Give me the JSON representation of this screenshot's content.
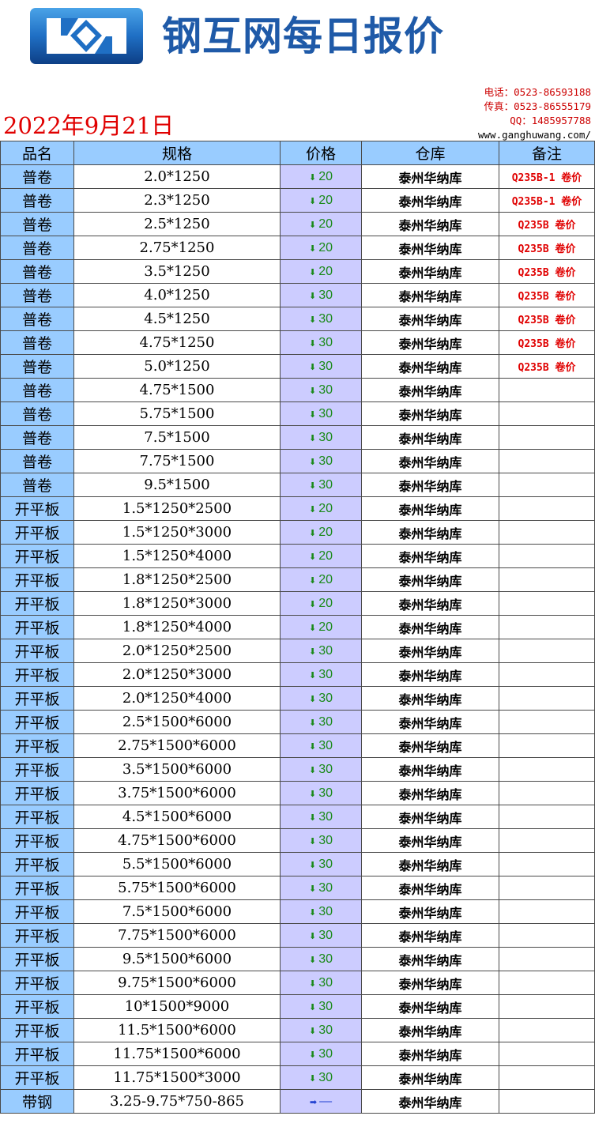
{
  "header": {
    "title": "钢互网每日报价",
    "phone": "电话：0523-86593188",
    "fax": "传真：0523-86555179",
    "qq": "QQ：1485957788",
    "website": "www.ganghuwang.com/",
    "date": "2022年9月21日",
    "colors": {
      "title": "#1f5aa8",
      "date": "#e00000",
      "header_bg": "#99ccff",
      "price_bg": "#ccccff",
      "down": "#1a8a1a",
      "flat": "#1f3fd0"
    }
  },
  "table": {
    "headers": [
      "品名",
      "规格",
      "价格",
      "仓库",
      "备注"
    ],
    "rows": [
      {
        "name": "普卷",
        "spec": "2.0*1250",
        "trend": "down",
        "price": "20",
        "warehouse": "泰州华纳库",
        "note": "Q235B-1 卷价"
      },
      {
        "name": "普卷",
        "spec": "2.3*1250",
        "trend": "down",
        "price": "20",
        "warehouse": "泰州华纳库",
        "note": "Q235B-1 卷价"
      },
      {
        "name": "普卷",
        "spec": "2.5*1250",
        "trend": "down",
        "price": "20",
        "warehouse": "泰州华纳库",
        "note": "Q235B 卷价"
      },
      {
        "name": "普卷",
        "spec": "2.75*1250",
        "trend": "down",
        "price": "20",
        "warehouse": "泰州华纳库",
        "note": "Q235B 卷价"
      },
      {
        "name": "普卷",
        "spec": "3.5*1250",
        "trend": "down",
        "price": "20",
        "warehouse": "泰州华纳库",
        "note": "Q235B 卷价"
      },
      {
        "name": "普卷",
        "spec": "4.0*1250",
        "trend": "down",
        "price": "30",
        "warehouse": "泰州华纳库",
        "note": "Q235B 卷价"
      },
      {
        "name": "普卷",
        "spec": "4.5*1250",
        "trend": "down",
        "price": "30",
        "warehouse": "泰州华纳库",
        "note": "Q235B 卷价"
      },
      {
        "name": "普卷",
        "spec": "4.75*1250",
        "trend": "down",
        "price": "30",
        "warehouse": "泰州华纳库",
        "note": "Q235B 卷价"
      },
      {
        "name": "普卷",
        "spec": "5.0*1250",
        "trend": "down",
        "price": "30",
        "warehouse": "泰州华纳库",
        "note": "Q235B 卷价"
      },
      {
        "name": "普卷",
        "spec": "4.75*1500",
        "trend": "down",
        "price": "30",
        "warehouse": "泰州华纳库",
        "note": ""
      },
      {
        "name": "普卷",
        "spec": "5.75*1500",
        "trend": "down",
        "price": "30",
        "warehouse": "泰州华纳库",
        "note": ""
      },
      {
        "name": "普卷",
        "spec": "7.5*1500",
        "trend": "down",
        "price": "30",
        "warehouse": "泰州华纳库",
        "note": ""
      },
      {
        "name": "普卷",
        "spec": "7.75*1500",
        "trend": "down",
        "price": "30",
        "warehouse": "泰州华纳库",
        "note": ""
      },
      {
        "name": "普卷",
        "spec": "9.5*1500",
        "trend": "down",
        "price": "30",
        "warehouse": "泰州华纳库",
        "note": ""
      },
      {
        "name": "开平板",
        "spec": "1.5*1250*2500",
        "trend": "down",
        "price": "20",
        "warehouse": "泰州华纳库",
        "note": ""
      },
      {
        "name": "开平板",
        "spec": "1.5*1250*3000",
        "trend": "down",
        "price": "20",
        "warehouse": "泰州华纳库",
        "note": ""
      },
      {
        "name": "开平板",
        "spec": "1.5*1250*4000",
        "trend": "down",
        "price": "20",
        "warehouse": "泰州华纳库",
        "note": ""
      },
      {
        "name": "开平板",
        "spec": "1.8*1250*2500",
        "trend": "down",
        "price": "20",
        "warehouse": "泰州华纳库",
        "note": ""
      },
      {
        "name": "开平板",
        "spec": "1.8*1250*3000",
        "trend": "down",
        "price": "20",
        "warehouse": "泰州华纳库",
        "note": ""
      },
      {
        "name": "开平板",
        "spec": "1.8*1250*4000",
        "trend": "down",
        "price": "20",
        "warehouse": "泰州华纳库",
        "note": ""
      },
      {
        "name": "开平板",
        "spec": "2.0*1250*2500",
        "trend": "down",
        "price": "30",
        "warehouse": "泰州华纳库",
        "note": ""
      },
      {
        "name": "开平板",
        "spec": "2.0*1250*3000",
        "trend": "down",
        "price": "30",
        "warehouse": "泰州华纳库",
        "note": ""
      },
      {
        "name": "开平板",
        "spec": "2.0*1250*4000",
        "trend": "down",
        "price": "30",
        "warehouse": "泰州华纳库",
        "note": ""
      },
      {
        "name": "开平板",
        "spec": "2.5*1500*6000",
        "trend": "down",
        "price": "30",
        "warehouse": "泰州华纳库",
        "note": ""
      },
      {
        "name": "开平板",
        "spec": "2.75*1500*6000",
        "trend": "down",
        "price": "30",
        "warehouse": "泰州华纳库",
        "note": ""
      },
      {
        "name": "开平板",
        "spec": "3.5*1500*6000",
        "trend": "down",
        "price": "30",
        "warehouse": "泰州华纳库",
        "note": ""
      },
      {
        "name": "开平板",
        "spec": "3.75*1500*6000",
        "trend": "down",
        "price": "30",
        "warehouse": "泰州华纳库",
        "note": ""
      },
      {
        "name": "开平板",
        "spec": "4.5*1500*6000",
        "trend": "down",
        "price": "30",
        "warehouse": "泰州华纳库",
        "note": ""
      },
      {
        "name": "开平板",
        "spec": "4.75*1500*6000",
        "trend": "down",
        "price": "30",
        "warehouse": "泰州华纳库",
        "note": ""
      },
      {
        "name": "开平板",
        "spec": "5.5*1500*6000",
        "trend": "down",
        "price": "30",
        "warehouse": "泰州华纳库",
        "note": ""
      },
      {
        "name": "开平板",
        "spec": "5.75*1500*6000",
        "trend": "down",
        "price": "30",
        "warehouse": "泰州华纳库",
        "note": ""
      },
      {
        "name": "开平板",
        "spec": "7.5*1500*6000",
        "trend": "down",
        "price": "30",
        "warehouse": "泰州华纳库",
        "note": ""
      },
      {
        "name": "开平板",
        "spec": "7.75*1500*6000",
        "trend": "down",
        "price": "30",
        "warehouse": "泰州华纳库",
        "note": ""
      },
      {
        "name": "开平板",
        "spec": "9.5*1500*6000",
        "trend": "down",
        "price": "30",
        "warehouse": "泰州华纳库",
        "note": ""
      },
      {
        "name": "开平板",
        "spec": "9.75*1500*6000",
        "trend": "down",
        "price": "30",
        "warehouse": "泰州华纳库",
        "note": ""
      },
      {
        "name": "开平板",
        "spec": "10*1500*9000",
        "trend": "down",
        "price": "30",
        "warehouse": "泰州华纳库",
        "note": ""
      },
      {
        "name": "开平板",
        "spec": "11.5*1500*6000",
        "trend": "down",
        "price": "30",
        "warehouse": "泰州华纳库",
        "note": ""
      },
      {
        "name": "开平板",
        "spec": "11.75*1500*6000",
        "trend": "down",
        "price": "30",
        "warehouse": "泰州华纳库",
        "note": ""
      },
      {
        "name": "开平板",
        "spec": "11.75*1500*3000",
        "trend": "down",
        "price": "30",
        "warehouse": "泰州华纳库",
        "note": ""
      },
      {
        "name": "带钢",
        "spec": "3.25-9.75*750-865",
        "trend": "flat",
        "price": "—",
        "warehouse": "泰州华纳库",
        "note": ""
      }
    ]
  }
}
